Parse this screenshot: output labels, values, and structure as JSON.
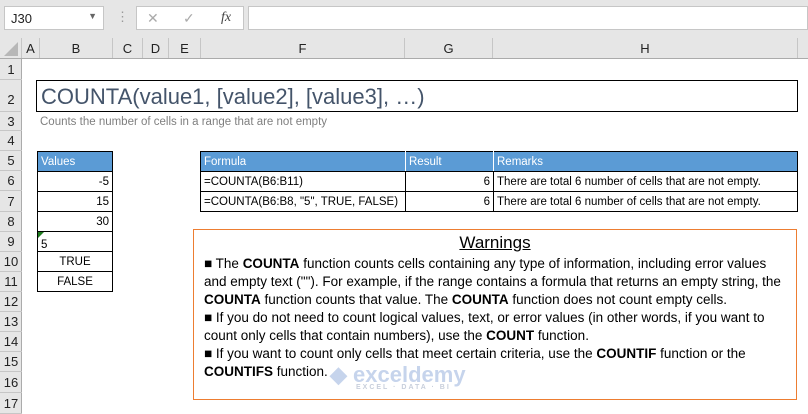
{
  "formula_bar": {
    "name_box": "J30",
    "fx": "fx",
    "cancel": "✕",
    "enter": "✓",
    "formula": ""
  },
  "columns": [
    "A",
    "B",
    "C",
    "D",
    "E",
    "F",
    "G",
    "H"
  ],
  "rows": [
    "1",
    "2",
    "3",
    "4",
    "5",
    "6",
    "7",
    "8",
    "9",
    "10",
    "11",
    "12",
    "13",
    "14",
    "15",
    "16",
    "17"
  ],
  "title": "COUNTA(value1, [value2], [value3], …)",
  "subtitle": "Counts the number of cells in a range that are not empty",
  "values_table": {
    "header": "Values",
    "items": [
      "-5",
      "15",
      "30",
      "5",
      "TRUE",
      "FALSE"
    ]
  },
  "formula_table": {
    "headers": [
      "Formula",
      "Result",
      "Remarks"
    ],
    "rows": [
      [
        "=COUNTA(B6:B11)",
        "6",
        "There are total 6 number of cells that are not empty."
      ],
      [
        "=COUNTA(B6:B8, \"5\", TRUE, FALSE)",
        "6",
        "There are total 6 number of cells that are not empty."
      ]
    ]
  },
  "warnings": {
    "title": "Warnings",
    "p1": [
      "The ",
      "COUNTA",
      " function counts cells containing any type of information, including error values and empty text (\"\"). For example, if the range contains a formula that returns an empty string, the ",
      "COUNTA",
      " function counts that value. The ",
      "COUNTA",
      " function does not count empty cells."
    ],
    "p2": [
      "If you do not need to count logical values, text, or error values (in other words, if you want to count only cells that contain numbers), use the ",
      "COUNT",
      " function."
    ],
    "p3": [
      "If you want to count only cells that meet certain criteria, use the ",
      "COUNTIF",
      " function or the ",
      "COUNTIFS",
      " function."
    ]
  },
  "watermark": {
    "name": "exceldemy",
    "tagline": "EXCEL · DATA · BI"
  }
}
